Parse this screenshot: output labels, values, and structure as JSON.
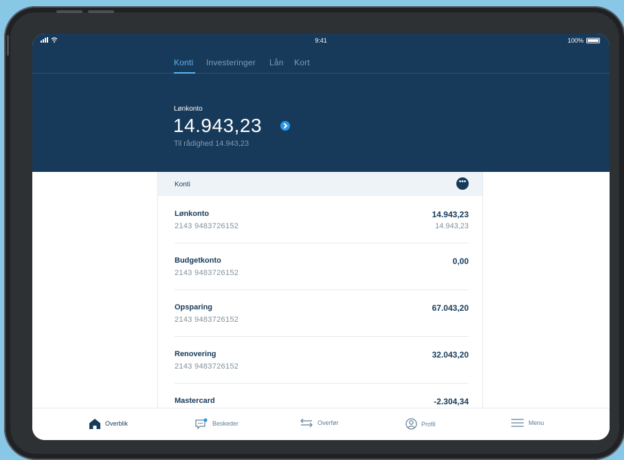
{
  "status_bar": {
    "time": "9:41",
    "battery": "100%"
  },
  "tabs": [
    {
      "label": "Konti",
      "active": true
    },
    {
      "label": "Investeringer",
      "active": false
    },
    {
      "label": "Lån",
      "active": false
    },
    {
      "label": "Kort",
      "active": false
    }
  ],
  "hero": {
    "account_label": "Lønkonto",
    "amount": "14.943,23",
    "available": "Til rådighed 14.943,23"
  },
  "accounts_card": {
    "title": "Konti",
    "rows": [
      {
        "name": "Lønkonto",
        "number": "2143 9483726152",
        "balance": "14.943,23",
        "available": "14.943,23"
      },
      {
        "name": "Budgetkonto",
        "number": "2143 9483726152",
        "balance": "0,00",
        "available": ""
      },
      {
        "name": "Opsparing",
        "number": "2143 9483726152",
        "balance": "67.043,20",
        "available": ""
      },
      {
        "name": "Renovering",
        "number": "2143 9483726152",
        "balance": "32.043,20",
        "available": ""
      },
      {
        "name": "Mastercard",
        "number": "",
        "balance": "-2.304,34",
        "available": ""
      }
    ]
  },
  "bottom_nav": [
    {
      "label": "Overblik",
      "icon": "home-icon",
      "active": true
    },
    {
      "label": "Beskeder",
      "icon": "message-icon",
      "active": false
    },
    {
      "label": "Overfør",
      "icon": "transfer-icon",
      "active": false
    },
    {
      "label": "Profil",
      "icon": "profile-icon",
      "active": false
    },
    {
      "label": "Menu",
      "icon": "menu-icon",
      "active": false
    }
  ],
  "colors": {
    "navy": "#173a5a",
    "accent": "#2a98e6",
    "background": "#88c7e6"
  }
}
